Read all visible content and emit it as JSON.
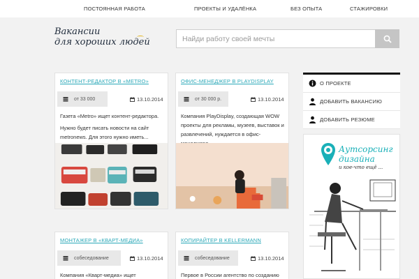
{
  "topnav": {
    "items": [
      "ПОСТОЯННАЯ РАБОТА",
      "ПРОЕКТЫ И УДАЛЁНКА",
      "БЕЗ ОПЫТА",
      "СТАЖИРОВКИ"
    ]
  },
  "logo": {
    "line1": "Вакансии",
    "line2": "для хороших людей"
  },
  "search": {
    "placeholder": "Найди работу своей мечты",
    "icon": "search-icon"
  },
  "jobs": [
    {
      "title": "КОНТЕНТ-РЕДАКТОР В «METRO»",
      "salary": "от 33 000",
      "date": "13.10.2014",
      "desc": [
        "Газета «Metro» ищет контент-редактора.",
        "Нужно будет писать новости на сайт metronews. Для этого нужно иметь..."
      ],
      "image": "typewriters"
    },
    {
      "title": "ОФИС-МЕНЕДЖЕР В PLAYDISPLAY",
      "salary": "от 30 000 р.",
      "date": "13.10.2014",
      "desc": [
        "Компания PlayDisplay, создающая WOW проекты для рекламы, музеев, выставок и развлечений, нуждается в офис-менеджере"
      ],
      "image": "office-woman"
    },
    {
      "title": "МОНТАЖЕР В «КВАРТ-МЕДИА»",
      "salary": "собеседование",
      "date": "13.10.2014",
      "desc": [
        "Компания «Кварт-медиа» ищет креативного"
      ]
    },
    {
      "title": "КОПИРАЙТЕР В KELLERMANN",
      "salary": "собеседование",
      "date": "13.10.2014",
      "desc": [
        "Первое в России агентство по созданию"
      ]
    }
  ],
  "sidemenu": {
    "items": [
      {
        "label": "О ПРОЕКТЕ",
        "icon": "info-icon"
      },
      {
        "label": "ДОБАВИТЬ ВАКАНСИЮ",
        "icon": "person-icon"
      },
      {
        "label": "ДОБАВИТЬ РЕЗЮМЕ",
        "icon": "person-icon"
      }
    ]
  },
  "ad": {
    "line1": "Аутсорсинг",
    "line2": "дизайна",
    "line3": "и кое-что ещё ...",
    "icon": "map-pin-icon",
    "image": "ergonomic-workstation-drawing"
  },
  "colors": {
    "accent": "#2aa8b8",
    "background": "#f2f2f2",
    "logo_accent": "#e2b31b"
  }
}
